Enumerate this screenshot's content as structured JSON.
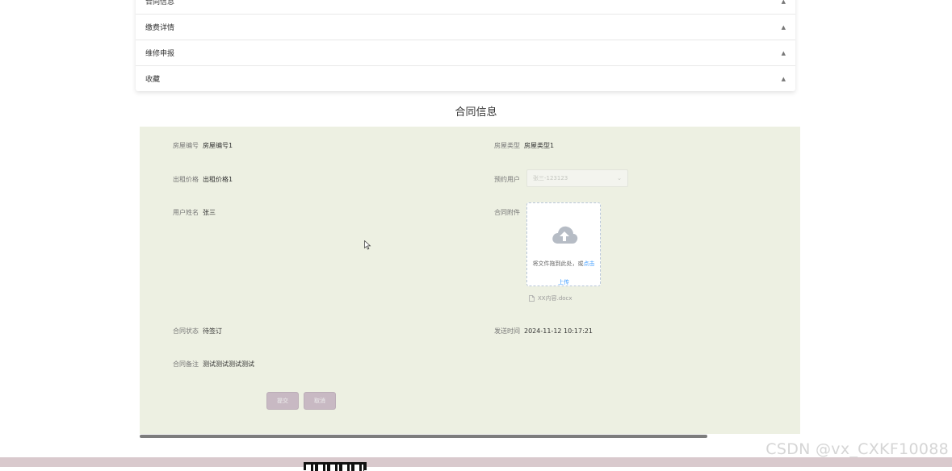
{
  "menu": {
    "items": [
      {
        "label": "合同信息"
      },
      {
        "label": "缴费详情"
      },
      {
        "label": "维修申报"
      },
      {
        "label": "收藏"
      }
    ]
  },
  "section_title": "合同信息",
  "form": {
    "house_no": {
      "label": "房屋编号",
      "value": "房屋编号1"
    },
    "house_type": {
      "label": "房屋类型",
      "value": "房屋类型1"
    },
    "rent_price": {
      "label": "出租价格",
      "value": "出租价格1"
    },
    "reserve_user": {
      "label": "预约用户",
      "value": "张三-123123"
    },
    "user_name": {
      "label": "用户姓名",
      "value": "张三"
    },
    "attachment": {
      "label": "合同附件",
      "drop_hint": "将文件拖到此处，或",
      "click_text": "点击",
      "upload_text": "上传",
      "file_name": "XX内容.docx"
    },
    "contract_status": {
      "label": "合同状态",
      "value": "待签订"
    },
    "send_time": {
      "label": "发送时间",
      "value": "2024-11-12 10:17:21"
    },
    "contract_note": {
      "label": "合同备注",
      "value": "测试测试测试测试"
    }
  },
  "buttons": {
    "submit": "提交",
    "cancel": "取消"
  },
  "watermark": "CSDN @vx_CXKF10088",
  "colors": {
    "panel_bg": "#edf0e2",
    "link": "#409eff",
    "button_bg": "#c8b9c3"
  }
}
